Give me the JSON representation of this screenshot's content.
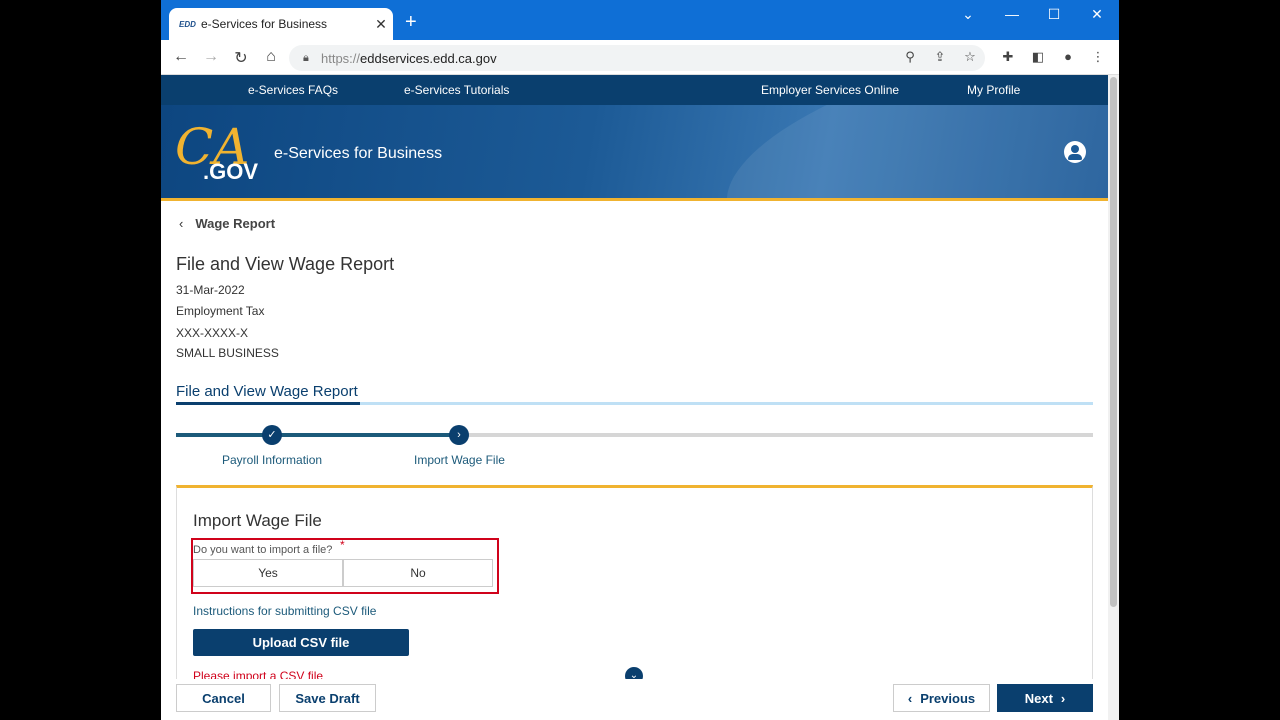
{
  "browser": {
    "tab_title": "e-Services for Business",
    "favicon_text": "EDD",
    "url_scheme": "https://",
    "url_host": "eddservices.edd.ca.gov"
  },
  "site_nav": {
    "items": [
      "e-Services FAQs",
      "e-Services Tutorials",
      "Employer Services Online",
      "My Profile"
    ]
  },
  "banner": {
    "logo_ca": "CA",
    "logo_gov": ".GOV",
    "title": "e-Services for Business"
  },
  "page": {
    "back_label": "Wage Report",
    "title": "File and View Wage Report",
    "date": "31-Mar-2022",
    "account_type": "Employment Tax",
    "account_number": "XXX-XXXX-X",
    "business_name": "SMALL BUSINESS",
    "section_title": "File and View Wage Report"
  },
  "stepper": {
    "steps": [
      {
        "label": "Payroll Information",
        "status": "complete"
      },
      {
        "label": "Import Wage File",
        "status": "current"
      }
    ]
  },
  "card": {
    "title": "Import Wage File",
    "question": "Do you want to import a file?",
    "required_marker": "*",
    "yes_label": "Yes",
    "no_label": "No",
    "instructions": "Instructions for submitting CSV file",
    "upload_label": "Upload CSV file",
    "error": "Please import a CSV file"
  },
  "footer": {
    "cancel": "Cancel",
    "save_draft": "Save Draft",
    "previous": "Previous",
    "next": "Next"
  },
  "colors": {
    "brand_blue": "#0a3f6e",
    "accent_gold": "#f0b330",
    "error_red": "#d0021b"
  }
}
